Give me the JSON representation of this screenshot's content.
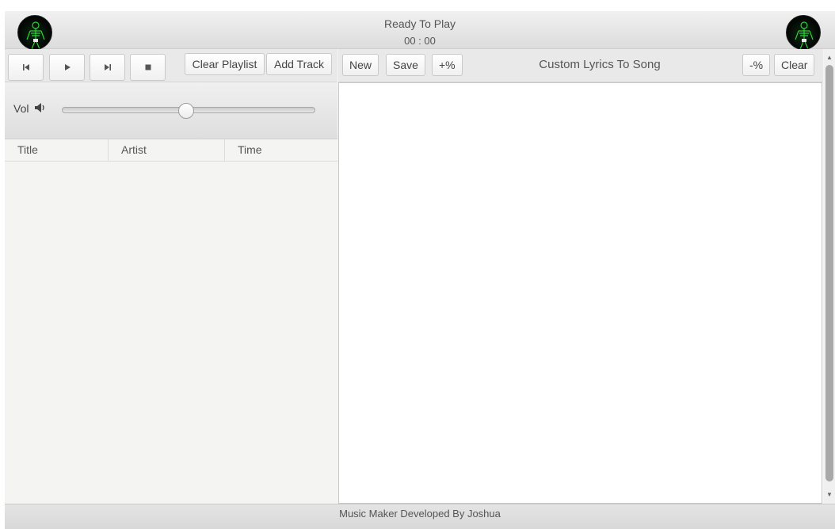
{
  "header": {
    "status": "Ready To Play",
    "time": "00 : 00",
    "logo_icon": "skeleton-logo-icon"
  },
  "transport": {
    "prev_icon": "skip-back-icon",
    "play_icon": "play-icon",
    "next_icon": "skip-forward-icon",
    "stop_icon": "stop-icon",
    "clear_playlist_label": "Clear Playlist",
    "add_track_label": "Add Track"
  },
  "volume": {
    "label": "Vol",
    "icon": "speaker-icon",
    "level": 0.49
  },
  "playlist": {
    "columns": [
      "Title",
      "Artist",
      "Time"
    ],
    "rows": []
  },
  "lyrics": {
    "new_label": "New",
    "save_label": "Save",
    "increase_label": "+%",
    "title": "Custom Lyrics To Song",
    "decrease_label": "-%",
    "clear_label": "Clear",
    "content": ""
  },
  "footer": {
    "text": "Music Maker Developed By Joshua"
  },
  "colors": {
    "panel_bg": "#f4f4f3",
    "toolbar_bg": "#e9e9e9",
    "logo_glow": "#2fd13a"
  }
}
